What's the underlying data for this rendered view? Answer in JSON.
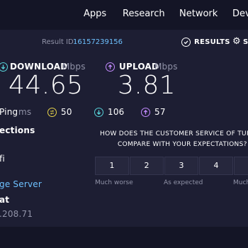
{
  "nav": {
    "items": [
      "Apps",
      "Research",
      "Network",
      "Dev"
    ]
  },
  "result": {
    "id_label": "Result ID",
    "id_value": "16157239156",
    "results_label": "RESULTS",
    "settings_label": "S"
  },
  "download": {
    "label": "DOWNLOAD",
    "unit": "Mbps",
    "value": "44.65"
  },
  "upload": {
    "label": "UPLOAD",
    "unit": "Mbps",
    "value": "3.81"
  },
  "ping": {
    "label": "Ping",
    "unit": "ms",
    "idle": "50",
    "down": "106",
    "up": "57"
  },
  "side": {
    "connections": "ections",
    "wifi": "fi",
    "server": "ge Server",
    "provider": "at",
    "ip": ".208.71"
  },
  "survey": {
    "line1": "HOW DOES THE CUSTOMER SERVICE OF TUR",
    "line2": "COMPARE WITH YOUR EXPECTATIONS?",
    "options": [
      "1",
      "2",
      "3",
      "4",
      ""
    ],
    "scale_low": "Much worse",
    "scale_mid": "As expected",
    "scale_high": "Much"
  },
  "colors": {
    "download": "#57d2d9",
    "upload": "#c48bff",
    "idle": "#e8d44a",
    "link": "#6ec1ff"
  }
}
